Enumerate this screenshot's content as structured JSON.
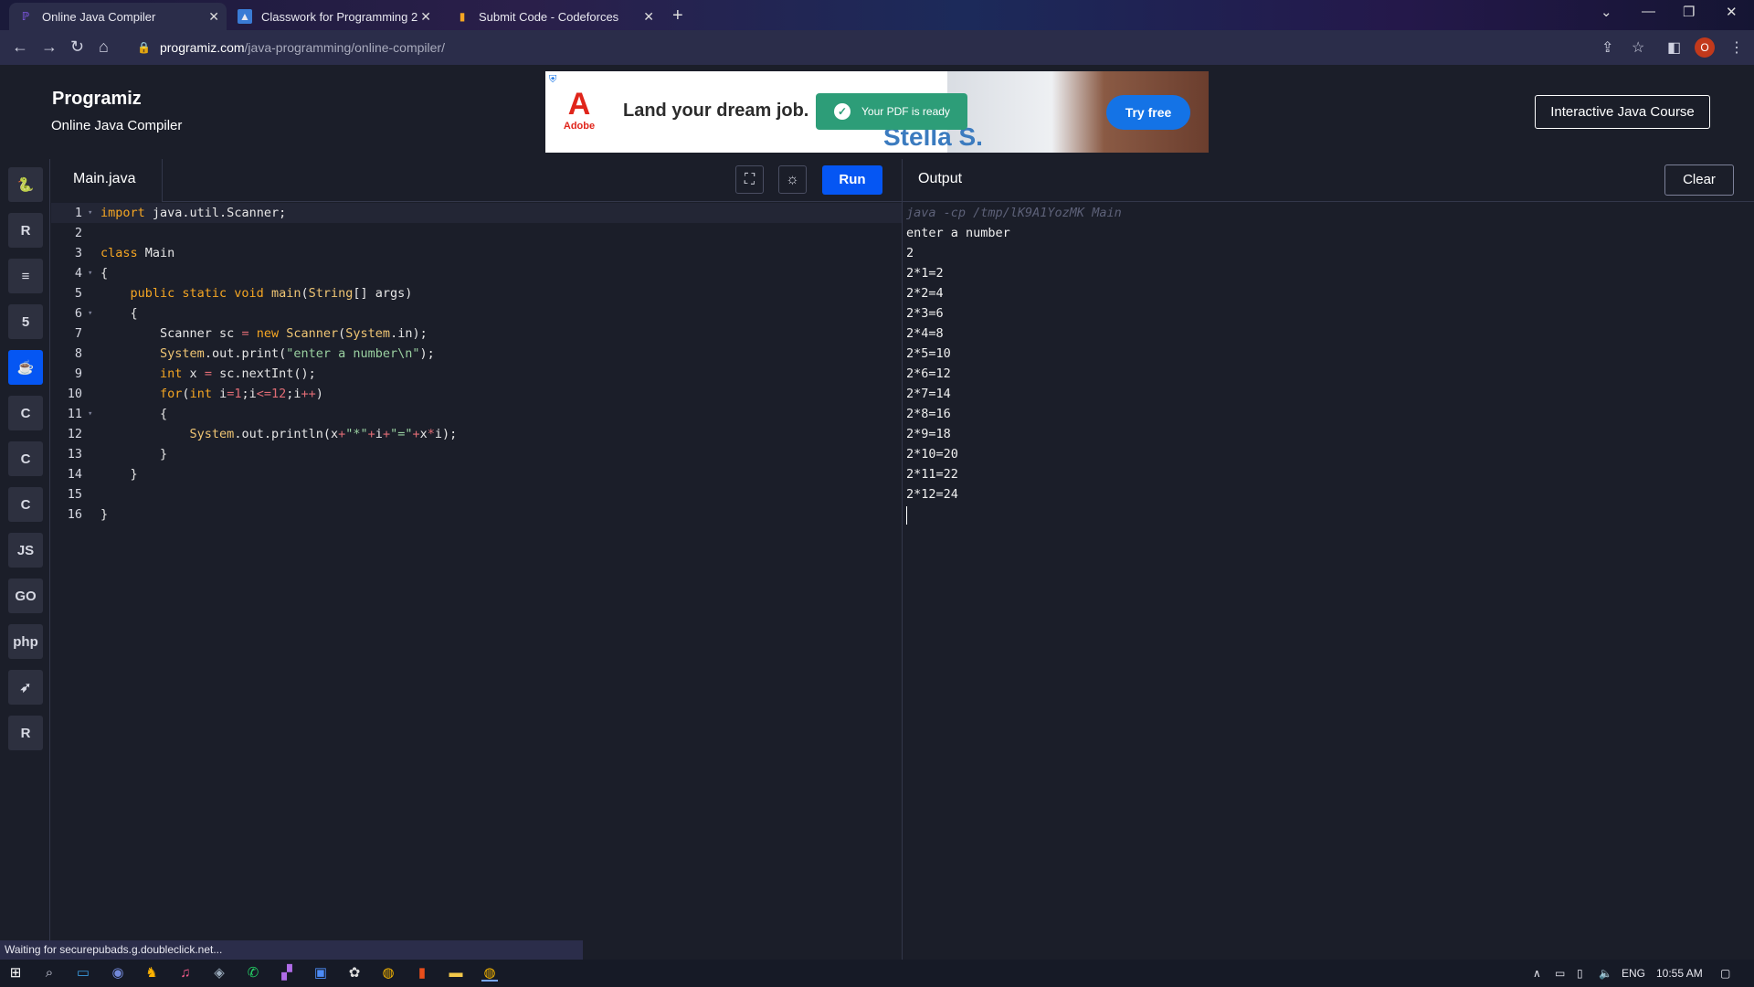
{
  "browser": {
    "tabs": [
      {
        "title": "Online Java Compiler",
        "favicon": "programiz-icon",
        "active": true
      },
      {
        "title": "Classwork for Programming 2",
        "favicon": "classroom-icon",
        "active": false
      },
      {
        "title": "Submit Code - Codeforces",
        "favicon": "codeforces-icon",
        "active": false
      }
    ],
    "url_host": "programiz.com",
    "url_path": "/java-programming/online-compiler/",
    "profile_initial": "O",
    "status_text": "Waiting for securepubads.g.doubleclick.net..."
  },
  "header": {
    "logo": "Programiz",
    "subtitle": "Online Java Compiler",
    "course_button": "Interactive Java Course"
  },
  "ad": {
    "brand": "Adobe",
    "headline": "Land your dream job.",
    "pdf_notice": "Your PDF is ready",
    "name_text": "Stella S.",
    "cta": "Try free"
  },
  "sidebar": {
    "languages": [
      {
        "name": "python",
        "glyph": "🐍",
        "active": false
      },
      {
        "name": "r",
        "glyph": "R",
        "active": false
      },
      {
        "name": "sql",
        "glyph": "≡",
        "active": false
      },
      {
        "name": "html",
        "glyph": "5",
        "active": false
      },
      {
        "name": "java",
        "glyph": "☕",
        "active": true
      },
      {
        "name": "c",
        "glyph": "C",
        "active": false
      },
      {
        "name": "cpp",
        "glyph": "C",
        "active": false
      },
      {
        "name": "csharp",
        "glyph": "C",
        "active": false
      },
      {
        "name": "javascript",
        "glyph": "JS",
        "active": false
      },
      {
        "name": "go",
        "glyph": "GO",
        "active": false
      },
      {
        "name": "php",
        "glyph": "php",
        "active": false
      },
      {
        "name": "swift",
        "glyph": "➶",
        "active": false
      },
      {
        "name": "rust",
        "glyph": "R",
        "active": false
      }
    ]
  },
  "editor": {
    "filename": "Main.java",
    "run_label": "Run",
    "lines": [
      {
        "n": "1",
        "fold": true,
        "html": "<span class=\"kw\">import</span> java.util.Scanner;"
      },
      {
        "n": "2",
        "fold": false,
        "html": ""
      },
      {
        "n": "3",
        "fold": false,
        "html": "<span class=\"kw\">class</span> Main"
      },
      {
        "n": "4",
        "fold": true,
        "html": "{"
      },
      {
        "n": "5",
        "fold": false,
        "html": "    <span class=\"kw\">public static void</span> <span class=\"cls\">main</span>(<span class=\"cls\">String</span>[] args)"
      },
      {
        "n": "6",
        "fold": true,
        "html": "    {"
      },
      {
        "n": "7",
        "fold": false,
        "html": "        Scanner sc <span class=\"op\">=</span> <span class=\"kw\">new</span> <span class=\"cls\">Scanner</span>(<span class=\"cls\">System</span>.in);"
      },
      {
        "n": "8",
        "fold": false,
        "html": "        <span class=\"cls\">System</span>.out.print(<span class=\"str\">\"enter a number\\n\"</span>);"
      },
      {
        "n": "9",
        "fold": false,
        "html": "        <span class=\"kw\">int</span> x <span class=\"op\">=</span> sc.nextInt();"
      },
      {
        "n": "10",
        "fold": false,
        "html": "        <span class=\"kw\">for</span>(<span class=\"kw\">int</span> i<span class=\"op\">=1</span>;i<span class=\"op\">&lt;=12</span>;i<span class=\"op\">++</span>)"
      },
      {
        "n": "11",
        "fold": true,
        "html": "        {"
      },
      {
        "n": "12",
        "fold": false,
        "html": "            <span class=\"cls\">System</span>.out.println(x<span class=\"op\">+</span><span class=\"str\">\"*\"</span><span class=\"op\">+</span>i<span class=\"op\">+</span><span class=\"str\">\"=\"</span><span class=\"op\">+</span>x<span class=\"op\">*</span>i);"
      },
      {
        "n": "13",
        "fold": false,
        "html": "        }"
      },
      {
        "n": "14",
        "fold": false,
        "html": "    }"
      },
      {
        "n": "15",
        "fold": false,
        "html": ""
      },
      {
        "n": "16",
        "fold": false,
        "html": "}"
      }
    ]
  },
  "output": {
    "title": "Output",
    "clear_label": "Clear",
    "command": "java -cp /tmp/lK9A1YozMK Main",
    "lines": [
      "enter a number",
      "2",
      "2*1=2",
      "2*2=4",
      "2*3=6",
      "2*4=8",
      "2*5=10",
      "2*6=12",
      "2*7=14",
      "2*8=16",
      "2*9=18",
      "2*10=20",
      "2*11=22",
      "2*12=24"
    ]
  },
  "taskbar": {
    "language": "ENG",
    "time": "10:55 AM"
  }
}
